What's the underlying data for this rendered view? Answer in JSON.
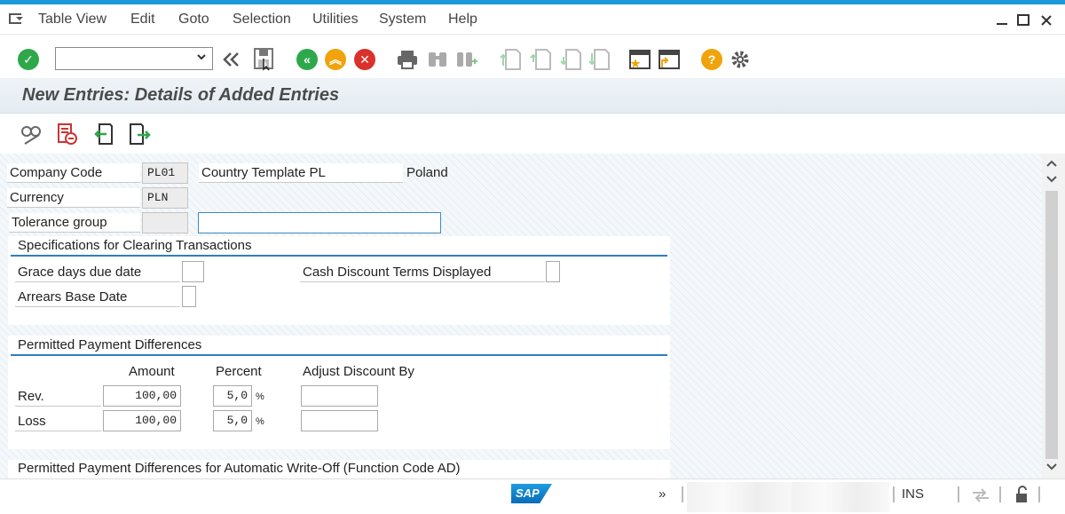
{
  "menubar": {
    "items": [
      "Table View",
      "Edit",
      "Goto",
      "Selection",
      "Utilities",
      "System",
      "Help"
    ]
  },
  "toolbar": {
    "command_value": "",
    "icons": [
      "enter-icon",
      "back-history-icon",
      "save-icon",
      "back-icon",
      "exit-icon",
      "cancel-icon",
      "print-icon",
      "find-icon",
      "find-next-icon",
      "first-page-icon",
      "previous-page-icon",
      "next-page-icon",
      "last-page-icon",
      "create-session-icon",
      "create-shortcut-icon",
      "help-icon",
      "customize-layout-icon"
    ]
  },
  "page": {
    "title": "New Entries: Details of Added Entries"
  },
  "header_fields": {
    "company_code_label": "Company Code",
    "company_code_value": "PL01",
    "company_name": "Country Template PL",
    "company_country": "Poland",
    "currency_label": "Currency",
    "currency_value": "PLN",
    "tolerance_group_label": "Tolerance group",
    "tolerance_group_value": "",
    "tolerance_desc_value": ""
  },
  "clearing": {
    "title": "Specifications for Clearing Transactions",
    "grace_days_label": "Grace days due date",
    "grace_days_value": "",
    "cash_discount_label": "Cash Discount Terms Displayed",
    "cash_discount_value": "",
    "arrears_label": "Arrears Base Date",
    "arrears_value": ""
  },
  "payment_diff": {
    "title": "Permitted Payment Differences",
    "col_amount": "Amount",
    "col_percent": "Percent",
    "col_adjust": "Adjust Discount By",
    "percent_sign": "%",
    "rows": [
      {
        "label": "Rev.",
        "amount": "100,00",
        "percent": "5,0",
        "adjust": ""
      },
      {
        "label": "Loss",
        "amount": "100,00",
        "percent": "5,0",
        "adjust": ""
      }
    ]
  },
  "auto_writeoff": {
    "title": "Permitted Payment Differences for Automatic Write-Off (Function Code AD)"
  },
  "statusbar": {
    "sap_logo": "SAP",
    "expand": "»",
    "mode": "INS"
  },
  "colors": {
    "accent": "#1a9ad9",
    "group_line": "#2e7fc1",
    "enter_green": "#2ea84a",
    "back_green": "#2ea84a",
    "exit_orange": "#f0a30a",
    "cancel_red": "#d9312b",
    "help_orange": "#f0a30a"
  }
}
